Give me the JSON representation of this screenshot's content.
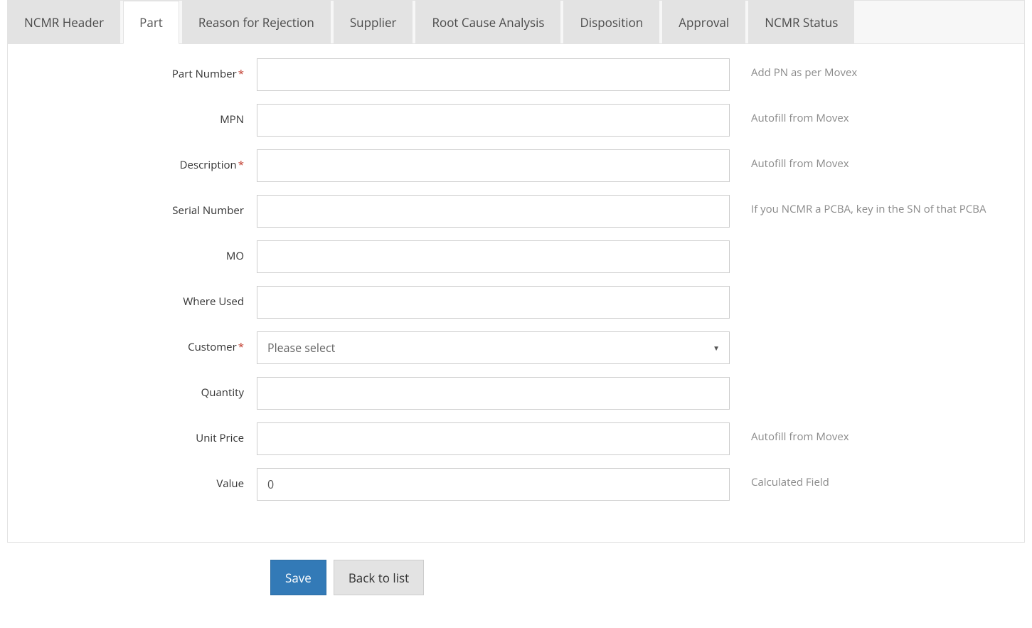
{
  "tabs": [
    {
      "label": "NCMR Header",
      "active": false
    },
    {
      "label": "Part",
      "active": true
    },
    {
      "label": "Reason for Rejection",
      "active": false
    },
    {
      "label": "Supplier",
      "active": false
    },
    {
      "label": "Root Cause Analysis",
      "active": false
    },
    {
      "label": "Disposition",
      "active": false
    },
    {
      "label": "Approval",
      "active": false
    },
    {
      "label": "NCMR Status",
      "active": false
    }
  ],
  "form": {
    "part_number": {
      "label": "Part Number",
      "required": true,
      "value": "",
      "help": "Add PN as per Movex"
    },
    "mpn": {
      "label": "MPN",
      "required": false,
      "value": "",
      "help": "Autofill from Movex"
    },
    "description": {
      "label": "Description",
      "required": true,
      "value": "",
      "help": "Autofill from Movex"
    },
    "serial_number": {
      "label": "Serial Number",
      "required": false,
      "value": "",
      "help": "If you NCMR a PCBA, key in the SN of that PCBA"
    },
    "mo": {
      "label": "MO",
      "required": false,
      "value": "",
      "help": ""
    },
    "where_used": {
      "label": "Where Used",
      "required": false,
      "value": "",
      "help": ""
    },
    "customer": {
      "label": "Customer",
      "required": true,
      "placeholder": "Please select",
      "help": ""
    },
    "quantity": {
      "label": "Quantity",
      "required": false,
      "value": "",
      "help": ""
    },
    "unit_price": {
      "label": "Unit Price",
      "required": false,
      "value": "",
      "help": "Autofill from Movex"
    },
    "value": {
      "label": "Value",
      "required": false,
      "value": "0",
      "help": "Calculated Field"
    }
  },
  "required_mark": "*",
  "buttons": {
    "save": "Save",
    "back": "Back to list"
  }
}
